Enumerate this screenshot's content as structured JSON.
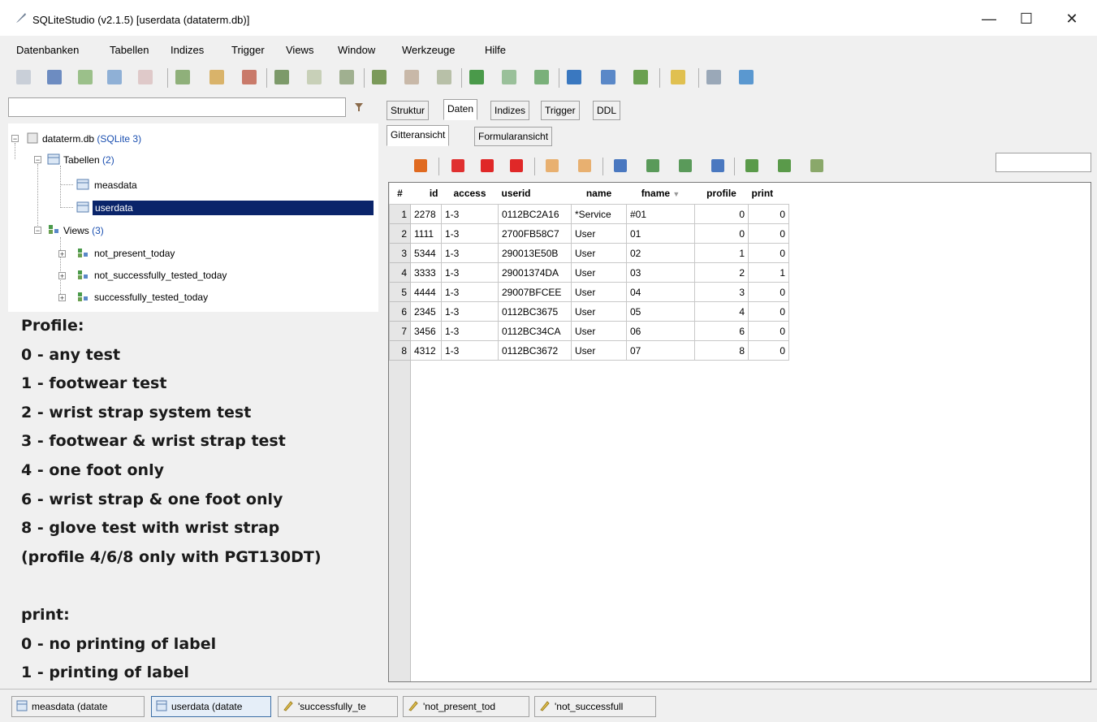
{
  "window": {
    "title": "SQLiteStudio (v2.1.5) [userdata (dataterm.db)]",
    "minimize": "—",
    "maximize": "☐",
    "close": "✕"
  },
  "menu": [
    "Datenbanken",
    "Tabellen",
    "Indizes",
    "Trigger",
    "Views",
    "Window",
    "Werkzeuge",
    "Hilfe"
  ],
  "tree": {
    "database": "dataterm.db",
    "database_type": "(SQLite 3)",
    "tables_label": "Tabellen",
    "tables_count": "(2)",
    "tables": [
      "measdata",
      "userdata"
    ],
    "views_label": "Views",
    "views_count": "(3)",
    "views": [
      "not_present_today",
      "not_successfully_tested_today",
      "successfully_tested_today"
    ]
  },
  "notes": [
    "Profile:",
    "0 - any test",
    "1 - footwear test",
    "2 - wrist strap system test",
    "3 - footwear & wrist strap test",
    "4 - one foot only",
    "6 - wrist strap & one foot only",
    "8 - glove test with wrist strap",
    "(profile 4/6/8 only with PGT130DT)",
    "",
    "print:",
    "0 - no printing of label",
    "1 - printing of label"
  ],
  "tabs": [
    "Struktur",
    "Daten",
    "Indizes",
    "Trigger",
    "DDL"
  ],
  "active_tab": "Daten",
  "subtabs": [
    "Gitteransicht",
    "Formularansicht"
  ],
  "grid": {
    "columns": [
      "#",
      "id",
      "access",
      "userid",
      "name",
      "fname",
      "profile",
      "print"
    ],
    "sort_indicator": "▼",
    "rows": [
      [
        "1",
        "2278",
        "1-3",
        "0112BC2A16",
        "*Service",
        "#01",
        "0",
        "0"
      ],
      [
        "2",
        "1111",
        "1-3",
        "2700FB58C7",
        "User",
        "01",
        "0",
        "0"
      ],
      [
        "3",
        "5344",
        "1-3",
        "290013E50B",
        "User",
        "02",
        "1",
        "0"
      ],
      [
        "4",
        "3333",
        "1-3",
        "29001374DA",
        "User",
        "03",
        "2",
        "1"
      ],
      [
        "5",
        "4444",
        "1-3",
        "29007BFCEE",
        "User",
        "04",
        "3",
        "0"
      ],
      [
        "6",
        "2345",
        "1-3",
        "0112BC3675",
        "User",
        "05",
        "4",
        "0"
      ],
      [
        "7",
        "3456",
        "1-3",
        "0112BC34CA",
        "User",
        "06",
        "6",
        "0"
      ],
      [
        "8",
        "4312",
        "1-3",
        "0112BC3672",
        "User",
        "07",
        "8",
        "0"
      ]
    ]
  },
  "taskbar": [
    {
      "label": "measdata (datate",
      "icon": "table-icon"
    },
    {
      "label": "userdata (datate",
      "icon": "table-icon"
    },
    {
      "label": "'successfully_te",
      "icon": "edit-icon"
    },
    {
      "label": "'not_present_tod",
      "icon": "edit-icon"
    },
    {
      "label": "'not_successfull",
      "icon": "edit-icon"
    }
  ],
  "colors": {
    "selection": "#0a246a",
    "link_blue": "#1a4fb0",
    "background": "#f0f0f0"
  }
}
